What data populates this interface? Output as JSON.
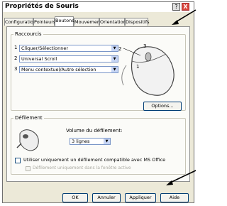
{
  "window": {
    "title": "Propriétés de Souris"
  },
  "titlebar_buttons": {
    "help": "?",
    "close": "X"
  },
  "tabs": [
    {
      "label": "Configuration",
      "active": false
    },
    {
      "label": "Pointeurs",
      "active": false
    },
    {
      "label": "Boutons",
      "active": true
    },
    {
      "label": "Mouvement",
      "active": false
    },
    {
      "label": "Orientation",
      "active": false
    },
    {
      "label": "Dispositifs",
      "active": false
    }
  ],
  "shortcuts": {
    "legend": "Raccourcis",
    "rows": [
      {
        "num": "1",
        "value": "Cliquer/Sélectionner"
      },
      {
        "num": "2",
        "value": "Universal Scroll"
      },
      {
        "num": "3",
        "value": "Menu contextuel/Autre sélection"
      }
    ],
    "mouse_labels": [
      "2",
      "3",
      "1"
    ],
    "options_button": "Options..."
  },
  "scroll": {
    "legend": "Défilement",
    "volume_label": "Volume du défilement:",
    "volume_value": "3 lignes",
    "office_checkbox": "Utiliser uniquement un défilement compatible avec MS Office",
    "active_window_checkbox": "Défilement uniquement dans la fenêtre active"
  },
  "footer": {
    "ok": "OK",
    "cancel": "Annuler",
    "apply": "Appliquer",
    "help": "Aide"
  }
}
